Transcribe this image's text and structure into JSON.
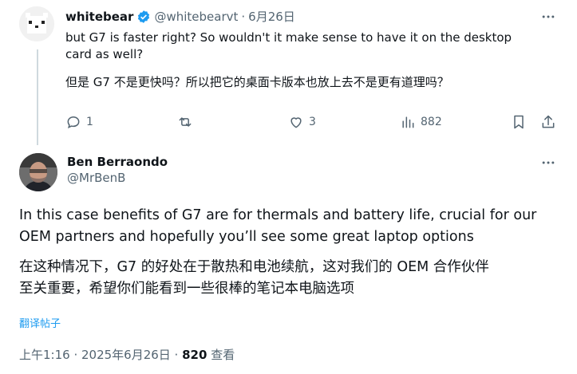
{
  "reply_tweet": {
    "display_name": "whitebear",
    "handle": "@whitebearvt",
    "separator": "·",
    "date": "6月26日",
    "text_en_line1": "but G7 is faster right? So wouldn't it make sense to have it on the desktop",
    "text_en_line2": "card as well?",
    "text_zh": "但是 G7 不是更快吗？所以把它的桌面卡版本也放上去不是更有道理吗？",
    "replies": "1",
    "retweets": "",
    "likes": "3",
    "views": "882"
  },
  "main_tweet": {
    "display_name": "Ben Berraondo",
    "handle": "@MrBenB",
    "text_en_line1": "In this case benefits of G7 are for thermals and battery life, crucial for our",
    "text_en_line2": "OEM partners and hopefully you’ll see some great laptop options",
    "text_zh_line1": "在这种情况下，G7 的好处在于散热和电池续航，这对我们的 OEM 合作伙伴",
    "text_zh_line2": "至关重要，希望你们能看到一些很棒的笔记本电脑选项",
    "translate_label": "翻译帖子",
    "timestamp": "上午1:16 · 2025年6月26日 ·",
    "views_count": "820",
    "views_label": "查看"
  },
  "colors": {
    "verified": "#1d9bf0",
    "muted": "#536471",
    "link": "#1d9bf0"
  }
}
